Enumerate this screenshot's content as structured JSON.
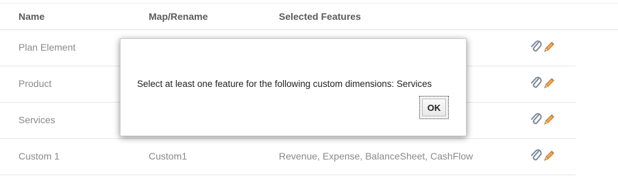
{
  "table": {
    "headers": {
      "name": "Name",
      "map_rename": "Map/Rename",
      "selected_features": "Selected Features"
    },
    "rows": [
      {
        "name": "Plan Element",
        "map_rename": "",
        "features": ""
      },
      {
        "name": "Product",
        "map_rename": "",
        "features": ""
      },
      {
        "name": "Services",
        "map_rename": "",
        "features": ""
      },
      {
        "name": "Custom 1",
        "map_rename": "Custom1",
        "features": "Revenue, Expense, BalanceSheet, CashFlow"
      }
    ],
    "row_icons": [
      "paperclip-icon",
      "pencil-icon"
    ]
  },
  "dialog": {
    "message": "Select at least one feature for the following custom dimensions: Services",
    "ok_label": "OK"
  },
  "colors": {
    "header_text": "#5b5b5b",
    "cell_text": "#8a8a8a",
    "pencil_orange": "#e08a2c",
    "clip_gray": "#7a8a99"
  }
}
